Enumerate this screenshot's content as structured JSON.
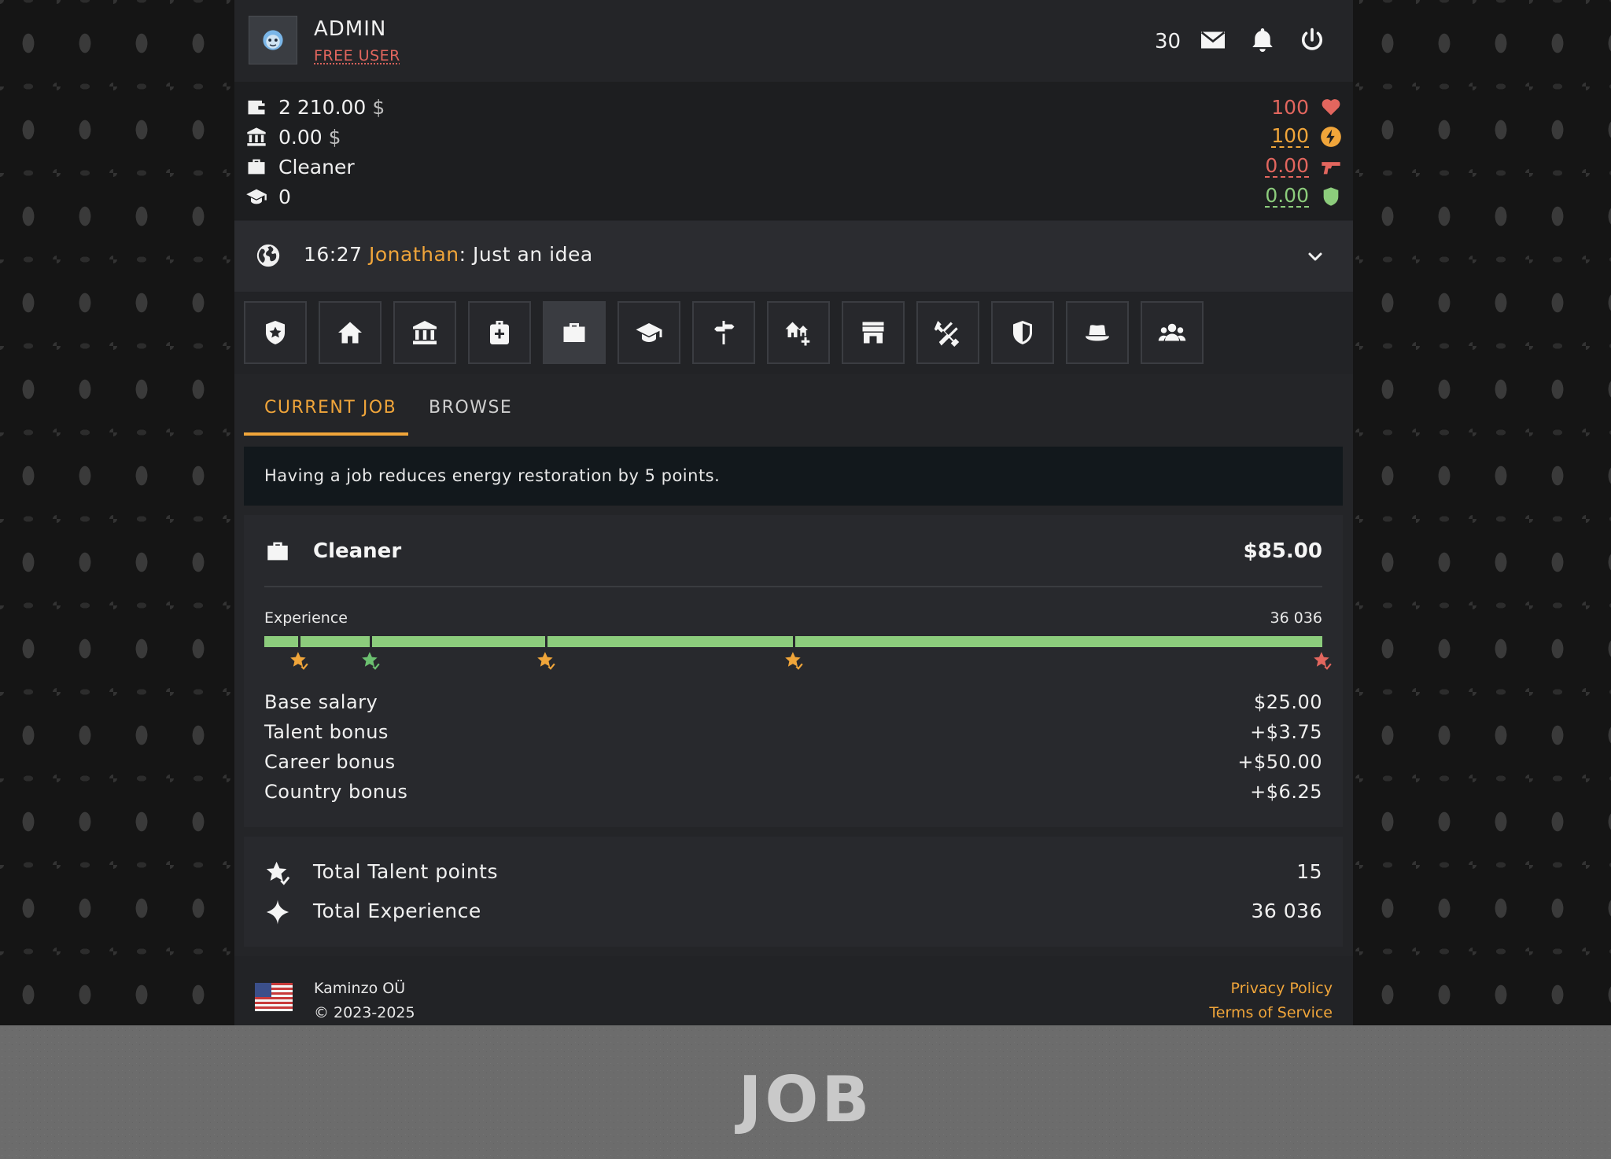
{
  "header": {
    "username": "ADMIN",
    "tier": "FREE USER",
    "notification_count": "30",
    "icons": [
      "mail-icon",
      "bell-icon",
      "power-icon"
    ]
  },
  "stats": {
    "cash": "2 210.00",
    "cash_unit": "$",
    "bank": "0.00",
    "bank_unit": "$",
    "job": "Cleaner",
    "education": "0",
    "health": "100",
    "energy": "100",
    "attack": "0.00",
    "defense": "0.00",
    "colors": {
      "health": "#e2665e",
      "energy": "#f0a53a",
      "attack": "#e2665e",
      "defense": "#8ccc7c"
    }
  },
  "chat": {
    "time": "16:27",
    "user": "Jonathan",
    "separator": ":",
    "message": "Just an idea"
  },
  "nav": {
    "items": [
      "police-badge-icon",
      "home-icon",
      "bank-icon",
      "hospital-bag-icon",
      "briefcase-icon",
      "graduation-cap-icon",
      "signpost-icon",
      "real-estate-icon",
      "store-icon",
      "gym-icon",
      "shield-icon",
      "gangster-hat-icon",
      "group-icon"
    ],
    "active_index": 4
  },
  "tabs": {
    "current": "CURRENT JOB",
    "browse": "BROWSE"
  },
  "notice": "Having a job reduces energy restoration by 5 points.",
  "job": {
    "title": "Cleaner",
    "pay": "$85.00",
    "experience_label": "Experience",
    "experience_value": "36 036",
    "progress_fraction": 1.0,
    "milestones": [
      {
        "fraction": 0.033,
        "color": "#f0a53a"
      },
      {
        "fraction": 0.1,
        "color": "#6cc070"
      },
      {
        "fraction": 0.266,
        "color": "#f0a53a"
      },
      {
        "fraction": 0.5,
        "color": "#f0a53a"
      },
      {
        "fraction": 1.0,
        "color": "#e2665e"
      }
    ],
    "rows": [
      {
        "label": "Base salary",
        "value": "$25.00"
      },
      {
        "label": "Talent bonus",
        "value": "+$3.75"
      },
      {
        "label": "Career bonus",
        "value": "+$50.00"
      },
      {
        "label": "Country bonus",
        "value": "+$6.25"
      }
    ]
  },
  "totals": {
    "talent_label": "Total Talent points",
    "talent_value": "15",
    "xp_label": "Total Experience",
    "xp_value": "36 036"
  },
  "footer": {
    "company": "Kaminzo OÜ",
    "copyright": "© 2023-2025",
    "privacy": "Privacy Policy",
    "terms": "Terms of Service"
  },
  "banner": {
    "title": "JOB"
  }
}
